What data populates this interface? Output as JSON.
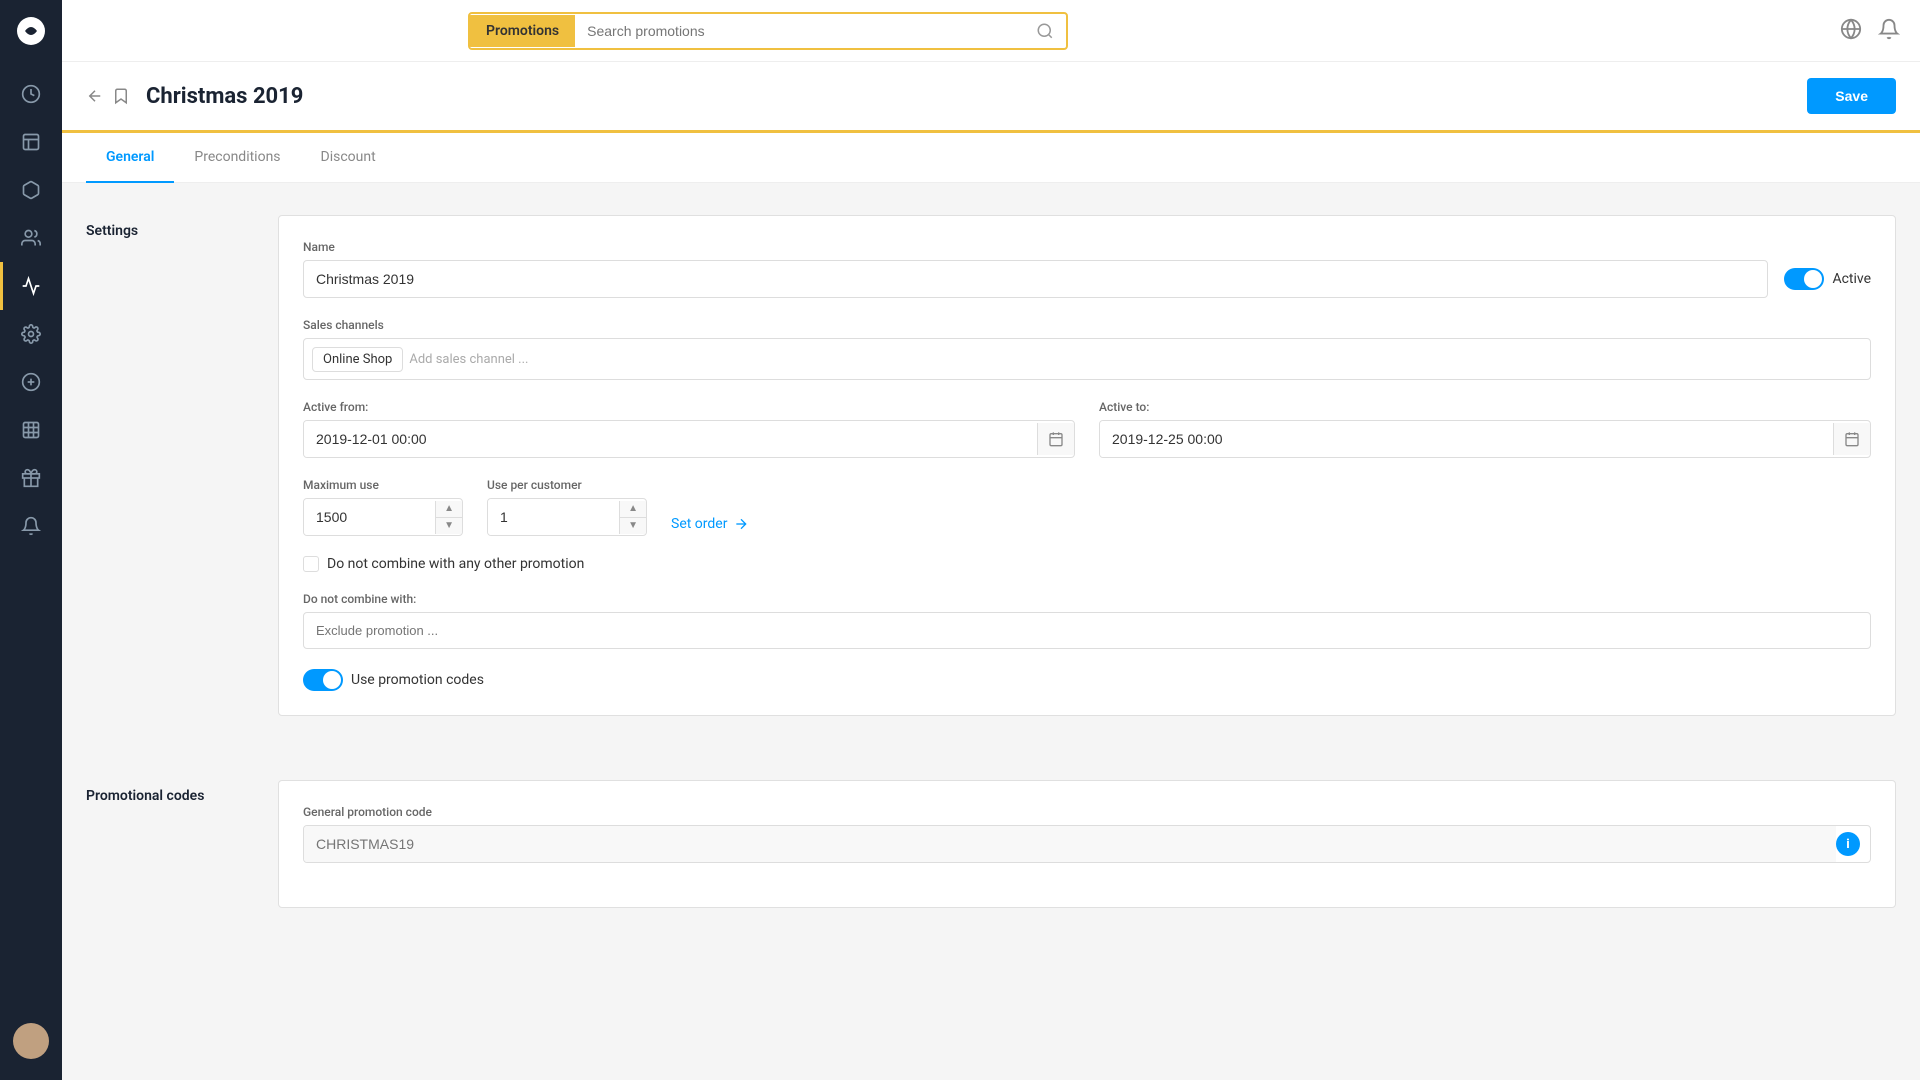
{
  "sidebar": {
    "items": [
      {
        "name": "dashboard",
        "icon": "circle-icon"
      },
      {
        "name": "orders",
        "icon": "grid-icon"
      },
      {
        "name": "products",
        "icon": "box-icon"
      },
      {
        "name": "customers",
        "icon": "users-icon"
      },
      {
        "name": "promotions",
        "icon": "megaphone-icon",
        "active": true
      },
      {
        "name": "settings",
        "icon": "gear-icon"
      },
      {
        "name": "add",
        "icon": "plus-icon"
      },
      {
        "name": "table",
        "icon": "table-icon"
      },
      {
        "name": "gift",
        "icon": "gift-icon"
      },
      {
        "name": "bell",
        "icon": "bell-icon"
      }
    ]
  },
  "topbar": {
    "search_tab": "Promotions",
    "search_placeholder": "Search promotions",
    "notifications_icon": "bell-icon",
    "globe_icon": "globe-icon"
  },
  "page_header": {
    "title": "Christmas 2019",
    "save_button": "Save"
  },
  "tabs": [
    {
      "label": "General",
      "active": true
    },
    {
      "label": "Preconditions",
      "active": false
    },
    {
      "label": "Discount",
      "active": false
    }
  ],
  "settings_section": {
    "label": "Settings",
    "name_label": "Name",
    "name_value": "Christmas 2019",
    "active_toggle": true,
    "active_label": "Active",
    "sales_channels_label": "Sales channels",
    "sales_channel_tag": "Online Shop",
    "sales_channel_placeholder": "Add sales channel ...",
    "active_from_label": "Active from:",
    "active_from_value": "2019-12-01 00:00",
    "active_to_label": "Active to:",
    "active_to_value": "2019-12-25 00:00",
    "max_use_label": "Maximum use",
    "max_use_value": "1500",
    "use_per_customer_label": "Use per customer",
    "use_per_customer_value": "1",
    "set_order_label": "Set order",
    "no_combine_label": "Do not combine with any other promotion",
    "do_not_combine_with_label": "Do not combine with:",
    "exclude_placeholder": "Exclude promotion ...",
    "use_promo_codes_label": "Use promotion codes",
    "use_promo_codes_active": true
  },
  "promotional_codes_section": {
    "label": "Promotional codes",
    "general_code_label": "General promotion code",
    "general_code_placeholder": "CHRISTMAS19",
    "info_label": "i"
  }
}
